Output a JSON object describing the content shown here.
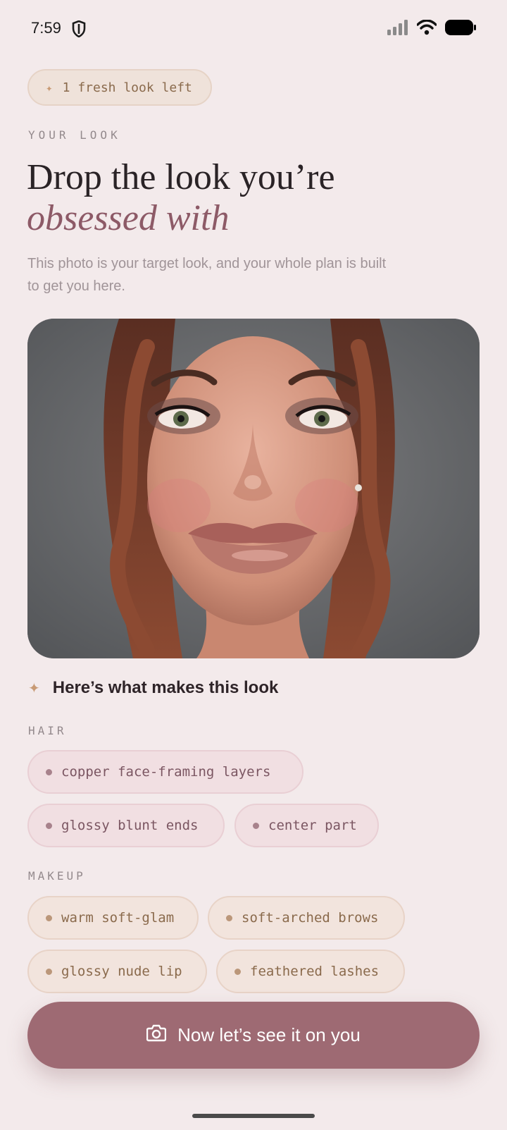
{
  "status_bar": {
    "time": "7:59",
    "icons": [
      "shield-icon",
      "signal-icon",
      "wifi-icon",
      "battery-icon"
    ]
  },
  "badge": {
    "label": "1 fresh look left",
    "icon": "sparkle-icon"
  },
  "kicker": "YOUR LOOK",
  "title": {
    "line1": "Drop the look you’re",
    "line2": "obsessed with"
  },
  "subtitle": "This photo is your target look, and your whole plan is built to get you here.",
  "photo": {
    "description_icon": "portrait-photo"
  },
  "breakdown": {
    "heading": "Here’s what makes this look",
    "icon": "sparkle-icon",
    "hair_label": "HAIR",
    "hair": [
      "copper face-framing layers",
      "glossy blunt ends",
      "center part"
    ],
    "makeup_label": "MAKEUP",
    "makeup": [
      "warm soft-glam",
      "soft-arched brows",
      "glossy nude lip",
      "feathered lashes"
    ]
  },
  "cta": {
    "label": "Now let’s see it on you",
    "icon": "camera-icon"
  },
  "colors": {
    "background": "#f3eaeb",
    "accent": "#9e6a73",
    "title_italic": "#8d5a67",
    "gold": "#c89a74"
  }
}
